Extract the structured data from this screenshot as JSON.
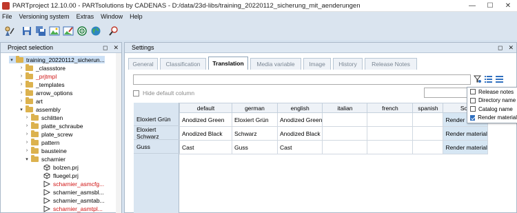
{
  "window": {
    "title": "PARTproject 12.10.00 - PARTsolutions by CADENAS - D:/data/23d-libs/training_20220112_sicherung_mit_aenderungen",
    "minimize": "—",
    "maximize": "☐",
    "close": "✕"
  },
  "menu": [
    "File",
    "Versioning system",
    "Extras",
    "Window",
    "Help"
  ],
  "toolbar_icons": [
    "wizard-icon",
    "save-icon",
    "save-all-icon",
    "image-icon",
    "image-edit-icon",
    "target-icon",
    "globe-icon",
    "search-settings-icon"
  ],
  "left_panel": {
    "title": "Project selection",
    "float_btn": "◻",
    "close_btn": "✕",
    "tree": [
      {
        "label": "training_20220112_sicherun...",
        "type": "folder",
        "level": 0,
        "expanded": true,
        "selected": true,
        "red": false
      },
      {
        "label": "_classstore",
        "type": "folder",
        "level": 1,
        "expanded": false,
        "red": false
      },
      {
        "label": "_prjtmpl",
        "type": "folder",
        "level": 1,
        "expanded": false,
        "red": true
      },
      {
        "label": "_templates",
        "type": "folder",
        "level": 1,
        "expanded": false,
        "red": false
      },
      {
        "label": "arrow_options",
        "type": "folder",
        "level": 1,
        "expanded": false,
        "red": false
      },
      {
        "label": "art",
        "type": "folder",
        "level": 1,
        "expanded": false,
        "red": false
      },
      {
        "label": "assembly",
        "type": "folder",
        "level": 1,
        "expanded": true,
        "red": false
      },
      {
        "label": "schlitten",
        "type": "folder",
        "level": 2,
        "expanded": false,
        "red": false
      },
      {
        "label": "platte_schraube",
        "type": "folder",
        "level": 2,
        "expanded": false,
        "red": false
      },
      {
        "label": "plate_screw",
        "type": "folder",
        "level": 2,
        "expanded": false,
        "red": false
      },
      {
        "label": "pattern",
        "type": "folder",
        "level": 2,
        "expanded": false,
        "red": false
      },
      {
        "label": "bausteine",
        "type": "folder",
        "level": 2,
        "expanded": false,
        "red": false
      },
      {
        "label": "scharnier",
        "type": "folder",
        "level": 2,
        "expanded": true,
        "red": false
      },
      {
        "label": "bolzen.prj",
        "type": "cube",
        "level": 3,
        "expanded": false,
        "red": false
      },
      {
        "label": "fluegel.prj",
        "type": "cube",
        "level": 3,
        "expanded": false,
        "red": false
      },
      {
        "label": "scharnier_asmcfg...",
        "type": "asm",
        "level": 3,
        "expanded": false,
        "red": true
      },
      {
        "label": "scharnier_asmsbl...",
        "type": "asm",
        "level": 3,
        "expanded": false,
        "red": false
      },
      {
        "label": "scharnier_asmtab...",
        "type": "asm",
        "level": 3,
        "expanded": false,
        "red": false
      },
      {
        "label": "scharnier_asmtpl...",
        "type": "asm",
        "level": 3,
        "expanded": false,
        "red": true
      }
    ]
  },
  "right_panel": {
    "title": "Settings",
    "float_btn": "◻",
    "close_btn": "✕",
    "tabs": [
      {
        "label": "General",
        "active": false
      },
      {
        "label": "Classification",
        "active": false
      },
      {
        "label": "Translation",
        "active": true
      },
      {
        "label": "Media variable",
        "active": false
      },
      {
        "label": "Image",
        "active": false
      },
      {
        "label": "History",
        "active": false
      },
      {
        "label": "Release Notes",
        "active": false
      }
    ],
    "filter_value": "",
    "hide_default_label": "Hide default column",
    "columns": [
      "default",
      "german",
      "english",
      "italian",
      "french",
      "spanish",
      "Sou"
    ],
    "rows": [
      {
        "header": "Eloxiert Grün",
        "cells": [
          "Anodized Green",
          "Eloxiert Grün",
          "Anodized Green",
          "",
          "",
          "",
          "Render material"
        ]
      },
      {
        "header": "Eloxiert Schwarz",
        "cells": [
          "Anodized Black",
          "Schwarz",
          "Anodized Black",
          "",
          "",
          "",
          "Render material"
        ]
      },
      {
        "header": "Guss",
        "cells": [
          "Cast",
          "Guss",
          "Cast",
          "",
          "",
          "",
          "Render material"
        ]
      }
    ],
    "popup": [
      {
        "label": "Release notes",
        "checked": false
      },
      {
        "label": "Directory name",
        "checked": false
      },
      {
        "label": "Catalog name",
        "checked": false
      },
      {
        "label": "Render material",
        "checked": true
      }
    ]
  }
}
